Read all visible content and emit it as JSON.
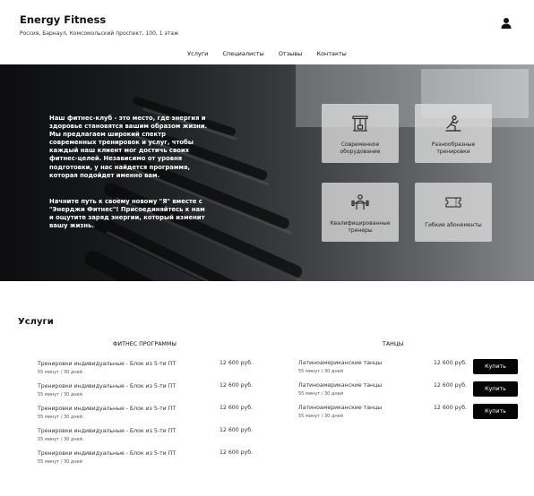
{
  "header": {
    "brand": "Energy Fitness",
    "address": "Россия, Барнаул, Комсомольский проспект, 100, 1 этаж",
    "user_icon": "user-icon"
  },
  "nav": {
    "items": [
      "Услуги",
      "Специалисты",
      "Отзывы",
      "Контакты"
    ]
  },
  "hero": {
    "paragraph1": "Наш фитнес-клуб - это место, где энергия и здоровье становятся вашим образом жизни. Мы предлагаем широкий спектр современных тренировок и услуг, чтобы каждый наш клиент мог достичь своих фитнес-целей. Независимо от уровня подготовки, у нас найдется программа, которая подойдет именно вам.",
    "paragraph2": "Начните путь к своему новому \"Я\" вместе с \"Энерджи Фитнес\"! Присоединяйтесь к нам и ощутите заряд энергии, который изменит вашу жизнь.",
    "features": [
      {
        "label": "Современное оборудование",
        "icon": "gym-equipment-icon"
      },
      {
        "label": "Разнообразные тренировки",
        "icon": "exercise-person-icon"
      },
      {
        "label": "Квалифицированные тренеры",
        "icon": "trainer-dumbbell-icon"
      },
      {
        "label": "Гибкие абонементы",
        "icon": "membership-ticket-icon"
      }
    ]
  },
  "services": {
    "title": "Услуги",
    "fitness": {
      "heading": "ФИТНЕС ПРОГРАММЫ",
      "items": [
        {
          "name": "Тренировки индивидуальные - Блок из 5-ти ПТ",
          "meta": "55 минут / 30 дней",
          "price": "12 600 руб."
        },
        {
          "name": "Тренировки индивидуальные - Блок из 5-ти ПТ",
          "meta": "55 минут / 30 дней",
          "price": "12 600 руб."
        },
        {
          "name": "Тренировки индивидуальные - Блок из 5-ти ПТ",
          "meta": "55 минут / 30 дней",
          "price": "12 600 руб."
        },
        {
          "name": "Тренировки индивидуальные - Блок из 5-ти ПТ",
          "meta": "55 минут / 30 дней",
          "price": "12 600 руб."
        },
        {
          "name": "Тренировки индивидуальные - Блок из 5-ти ПТ",
          "meta": "55 минут / 30 дней",
          "price": "12 600 руб."
        }
      ]
    },
    "dance": {
      "heading": "ТАНЦЫ",
      "items": [
        {
          "name": "Латиноамериканские танцы",
          "meta": "55 минут / 30 дней",
          "price": "12 600 руб.",
          "button": "Купить"
        },
        {
          "name": "Латиноамериканские танцы",
          "meta": "55 минут / 30 дней",
          "price": "12 600 руб.",
          "button": "Купить"
        },
        {
          "name": "Латиноамериканские танцы",
          "meta": "55 минут / 30 дней",
          "price": "12 600 руб.",
          "button": "Купить"
        }
      ]
    }
  }
}
